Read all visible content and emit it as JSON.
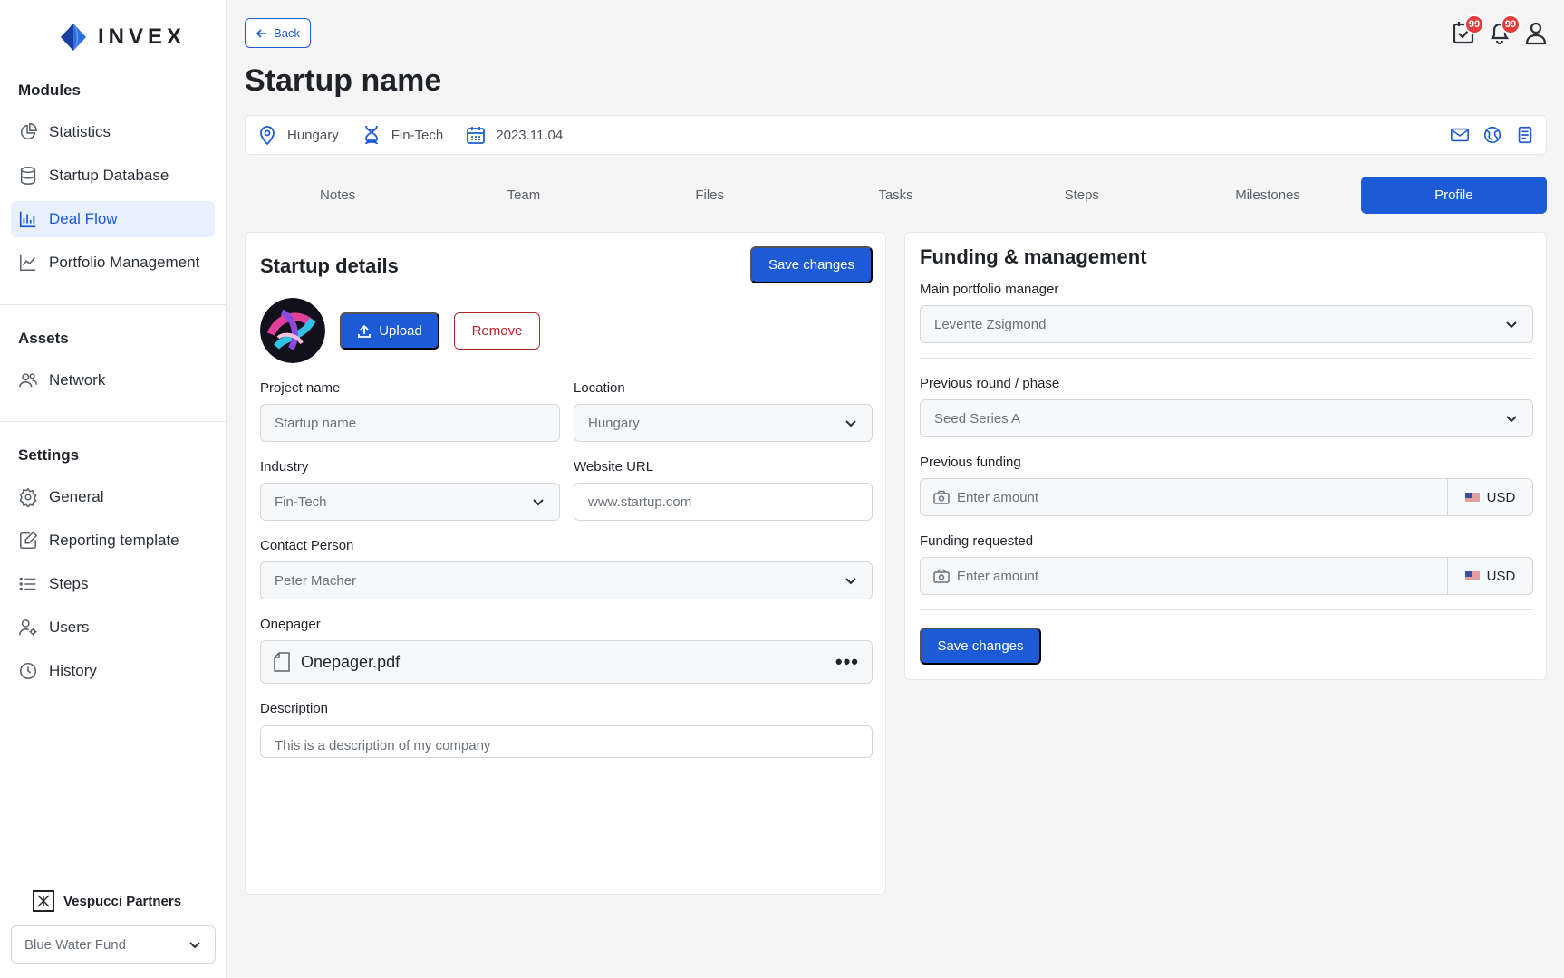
{
  "brand": {
    "name": "INVEX"
  },
  "sidebar": {
    "modules_title": "Modules",
    "modules": [
      {
        "label": "Statistics",
        "icon": "pie-chart-icon"
      },
      {
        "label": "Startup Database",
        "icon": "database-icon"
      },
      {
        "label": "Deal Flow",
        "icon": "bar-chart-icon",
        "active": true
      },
      {
        "label": "Portfolio Management",
        "icon": "line-chart-icon"
      }
    ],
    "assets_title": "Assets",
    "assets": [
      {
        "label": "Network",
        "icon": "people-icon"
      }
    ],
    "settings_title": "Settings",
    "settings": [
      {
        "label": "General",
        "icon": "gear-icon"
      },
      {
        "label": "Reporting template",
        "icon": "edit-document-icon"
      },
      {
        "label": "Steps",
        "icon": "list-icon"
      },
      {
        "label": "Users",
        "icon": "user-gear-icon"
      },
      {
        "label": "History",
        "icon": "clock-icon"
      }
    ],
    "org_name": "Vespucci Partners",
    "fund_select": "Blue Water Fund"
  },
  "header": {
    "back_label": "Back",
    "title": "Startup name",
    "tasks_badge": "99",
    "notifications_badge": "99"
  },
  "info_bar": {
    "location": "Hungary",
    "industry": "Fin-Tech",
    "date": "2023.11.04"
  },
  "tabs": [
    {
      "label": "Notes"
    },
    {
      "label": "Team"
    },
    {
      "label": "Files"
    },
    {
      "label": "Tasks"
    },
    {
      "label": "Steps"
    },
    {
      "label": "Milestones"
    },
    {
      "label": "Profile",
      "active": true
    }
  ],
  "startup_details": {
    "title": "Startup details",
    "save_label": "Save changes",
    "upload_label": "Upload",
    "remove_label": "Remove",
    "project_name_label": "Project name",
    "project_name_placeholder": "Startup name",
    "location_label": "Location",
    "location_value": "Hungary",
    "industry_label": "Industry",
    "industry_value": "Fin-Tech",
    "website_label": "Website URL",
    "website_placeholder": "www.startup.com",
    "contact_label": "Contact Person",
    "contact_value": "Peter Macher",
    "onepager_label": "Onepager",
    "onepager_file": "Onepager.pdf",
    "description_label": "Description",
    "description_placeholder": "This is a description of my company"
  },
  "funding": {
    "title": "Funding & management",
    "manager_label": "Main portfolio manager",
    "manager_value": "Levente Zsigmond",
    "round_label": "Previous round / phase",
    "round_value": "Seed Series A",
    "prev_funding_label": "Previous funding",
    "prev_funding_placeholder": "Enter amount",
    "prev_funding_currency": "USD",
    "requested_label": "Funding requested",
    "requested_placeholder": "Enter amount",
    "requested_currency": "USD",
    "save_label": "Save changes"
  },
  "colors": {
    "accent": "#1d5bd6",
    "danger": "#b42626",
    "badge": "#e23c3c"
  }
}
